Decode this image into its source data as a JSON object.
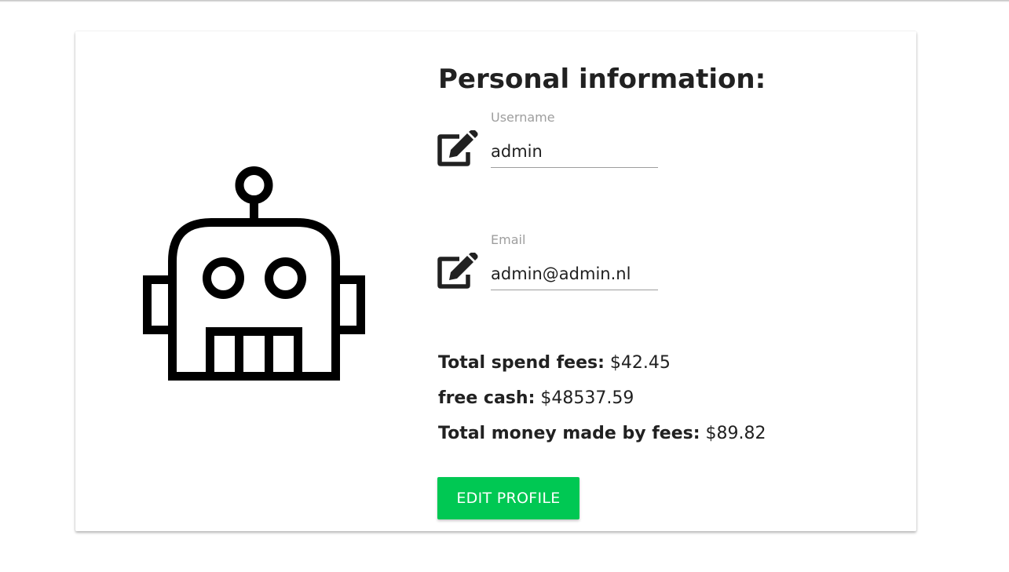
{
  "profile": {
    "title": "Personal information:",
    "avatar_icon": "robot-icon",
    "username": {
      "label": "Username",
      "value": "admin",
      "icon": "edit-icon"
    },
    "email": {
      "label": "Email",
      "value": "admin@admin.nl",
      "icon": "edit-icon"
    },
    "stats": [
      {
        "label": "Total spend fees:",
        "value": "$42.45"
      },
      {
        "label": "free cash:",
        "value": "$48537.59"
      },
      {
        "label": "Total money made by fees:",
        "value": "$89.82"
      }
    ],
    "edit_button_label": "EDIT PROFILE"
  },
  "colors": {
    "button": "#00c853",
    "text": "#212121",
    "label": "#9e9e9e"
  }
}
